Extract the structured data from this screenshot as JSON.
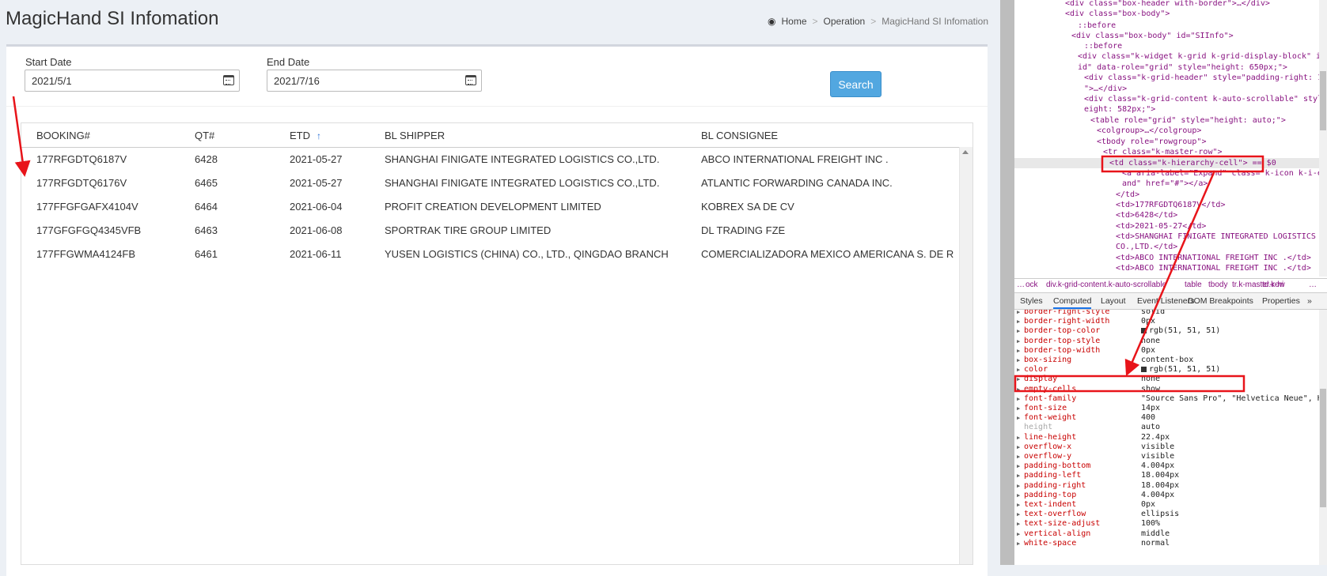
{
  "page": {
    "title": "MagicHand SI Infomation",
    "breadcrumb": {
      "home": "Home",
      "sep1": ">",
      "operation": "Operation",
      "sep2": ">",
      "current": "MagicHand SI Infomation"
    }
  },
  "filters": {
    "start_label": "Start Date",
    "start_value": "2021/5/1",
    "end_label": "End Date",
    "end_value": "2021/7/16",
    "search_label": "Search"
  },
  "grid": {
    "columns": [
      "BOOKING#",
      "QT#",
      "ETD",
      "BL SHIPPER",
      "BL CONSIGNEE"
    ],
    "sort_column": "ETD",
    "rows": [
      [
        "177RFGDTQ6187V",
        "6428",
        "2021-05-27",
        "SHANGHAI FINIGATE INTEGRATED LOGISTICS CO.,LTD.",
        "ABCO INTERNATIONAL FREIGHT INC ."
      ],
      [
        "177RFGDTQ6176V",
        "6465",
        "2021-05-27",
        "SHANGHAI FINIGATE INTEGRATED LOGISTICS CO.,LTD.",
        "ATLANTIC FORWARDING CANADA INC."
      ],
      [
        "177FFGFGAFX4104V",
        "6464",
        "2021-06-04",
        "PROFIT CREATION DEVELOPMENT LIMITED",
        "KOBREX SA DE CV"
      ],
      [
        "177GFGFGQ4345VFB",
        "6463",
        "2021-06-08",
        "SPORTRAK TIRE GROUP LIMITED",
        "DL TRADING FZE"
      ],
      [
        "177FFGWMA4124FB",
        "6461",
        "2021-06-11",
        "YUSEN LOGISTICS (CHINA) CO., LTD., QINGDAO BRANCH",
        "COMERCIALIZADORA MEXICO AMERICANA S. DE R.L. DE C"
      ]
    ]
  },
  "devtools": {
    "dom_lines": [
      "<div class=\"box-header with-border\">…</div>",
      "<div class=\"box-body\">",
      "::before",
      "<div class=\"box-body\" id=\"SIInfo\">",
      "::before",
      "<div class=\"k-widget k-grid k-grid-display-block\" id=\"gr",
      "id\" data-role=\"grid\" style=\"height: 650px;\">",
      "<div class=\"k-grid-header\" style=\"padding-right: 17px;",
      "\">…</div>",
      "<div class=\"k-grid-content k-auto-scrollable\" style=\"h",
      "eight: 582px;\">",
      "<table role=\"grid\" style=\"height: auto;\">",
      "<colgroup>…</colgroup>",
      "<tbody role=\"rowgroup\">",
      "<tr class=\"k-master-row\">",
      "<td class=\"k-hierarchy-cell\"> == $0",
      "<a aria-label=\"Expand\" class=\"k-icon k-i-exp",
      "and\" href=\"#\"></a>",
      "</td>",
      "<td>177RFGDTQ6187V</td>",
      "<td>6428</td>",
      "<td>2021-05-27</td>",
      "<td>SHANGHAI FINIGATE INTEGRATED LOGISTICS",
      "CO.,LTD.</td>",
      "<td>ABCO INTERNATIONAL FREIGHT INC .</td>",
      "<td>ABCO INTERNATIONAL FREIGHT INC .</td>"
    ],
    "crumbs": [
      "…",
      "ock",
      "div.k-grid-content.k-auto-scrollable",
      "table",
      "tbody",
      "tr.k-master-row",
      "td.k-hi",
      "…"
    ],
    "tabs": [
      "Styles",
      "Computed",
      "Layout",
      "Event Listeners",
      "DOM Breakpoints",
      "Properties",
      "»"
    ],
    "active_tab": "Computed",
    "props": [
      [
        "border-right-style",
        "solid"
      ],
      [
        "border-right-width",
        "0px"
      ],
      [
        "border-top-color",
        "rgb(51, 51, 51)"
      ],
      [
        "border-top-style",
        "none"
      ],
      [
        "border-top-width",
        "0px"
      ],
      [
        "box-sizing",
        "content-box"
      ],
      [
        "color",
        "rgb(51, 51, 51)"
      ],
      [
        "display",
        "none"
      ],
      [
        "empty-cells",
        "show"
      ],
      [
        "font-family",
        "\"Source Sans Pro\", \"Helvetica Neue\", Hel"
      ],
      [
        "font-size",
        "14px"
      ],
      [
        "font-weight",
        "400"
      ],
      [
        "height",
        "auto"
      ],
      [
        "line-height",
        "22.4px"
      ],
      [
        "overflow-x",
        "visible"
      ],
      [
        "overflow-y",
        "visible"
      ],
      [
        "padding-bottom",
        "4.004px"
      ],
      [
        "padding-left",
        "18.004px"
      ],
      [
        "padding-right",
        "18.004px"
      ],
      [
        "padding-top",
        "4.004px"
      ],
      [
        "text-indent",
        "0px"
      ],
      [
        "text-overflow",
        "ellipsis"
      ],
      [
        "text-size-adjust",
        "100%"
      ],
      [
        "vertical-align",
        "middle"
      ],
      [
        "white-space",
        "normal"
      ]
    ],
    "swatch_color": "#333333"
  },
  "annotation_color": "#e8141a"
}
